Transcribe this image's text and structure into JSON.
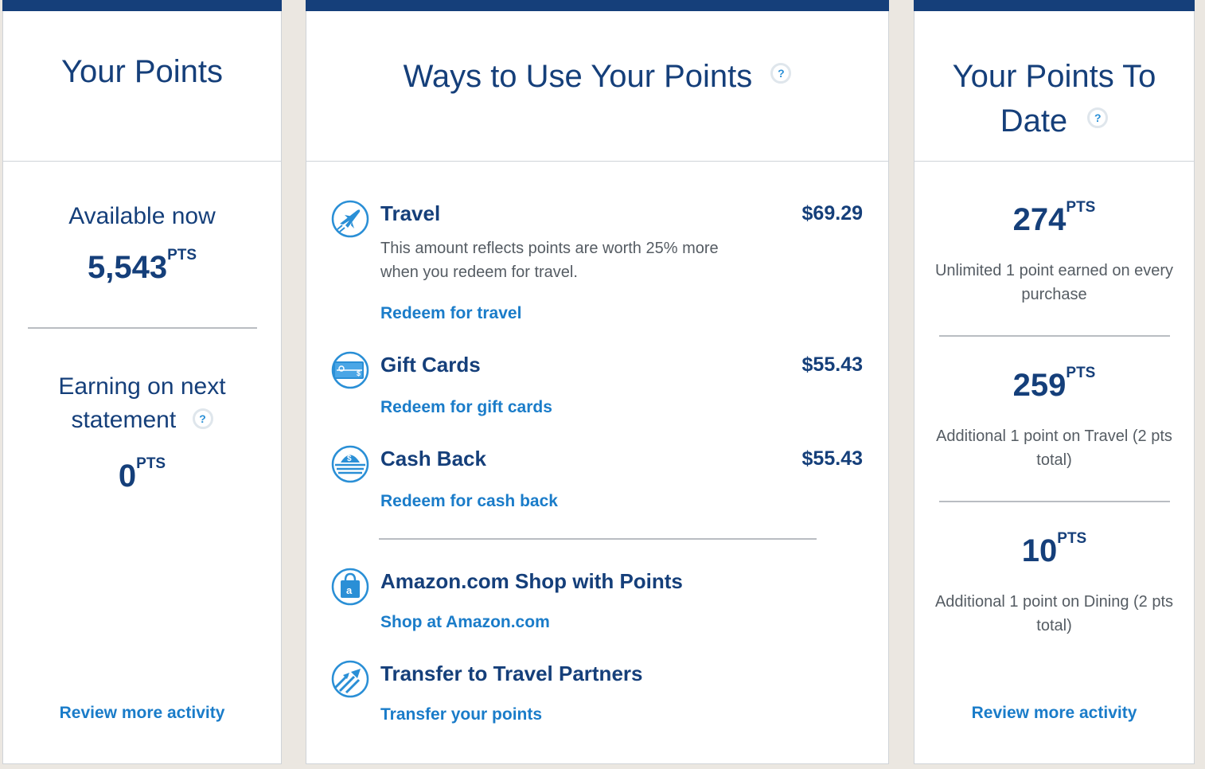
{
  "your_points": {
    "title": "Your Points",
    "available_label": "Available now",
    "available_value": "5,543",
    "pts_unit": "PTS",
    "earning_label_1": "Earning on next",
    "earning_label_2": "statement",
    "earning_value": "0",
    "help_glyph": "?",
    "review_link": "Review more activity"
  },
  "ways": {
    "title": "Ways to Use Your Points",
    "help_glyph": "?",
    "options": [
      {
        "icon": "airplane-icon",
        "title": "Travel",
        "value": "$69.29",
        "description": "This amount reflects points are worth 25% more when you redeem for travel.",
        "link": "Redeem for travel"
      },
      {
        "icon": "gift-card-icon",
        "title": "Gift Cards",
        "value": "$55.43",
        "link": "Redeem for gift cards"
      },
      {
        "icon": "cash-back-icon",
        "title": "Cash Back",
        "value": "$55.43",
        "link": "Redeem for cash back"
      },
      {
        "icon": "shopping-bag-icon",
        "title": "Amazon.com Shop with Points",
        "link": "Shop at Amazon.com"
      },
      {
        "icon": "transfer-arrows-icon",
        "title": "Transfer to Travel Partners",
        "link": "Transfer your points"
      }
    ]
  },
  "to_date": {
    "title_line1": "Your Points To",
    "title_line2": "Date",
    "help_glyph": "?",
    "pts_unit": "PTS",
    "items": [
      {
        "value": "274",
        "desc": "Unlimited 1 point earned on every purchase"
      },
      {
        "value": "259",
        "desc": "Additional 1 point on Travel (2 pts total)"
      },
      {
        "value": "10",
        "desc": "Additional 1 point on Dining (2 pts total)"
      }
    ],
    "review_link": "Review more activity"
  },
  "colors": {
    "navy": "#153f7a",
    "link_blue": "#1a7cc9",
    "icon_blue": "#2a8fd6",
    "background": "#ebe7e1"
  }
}
